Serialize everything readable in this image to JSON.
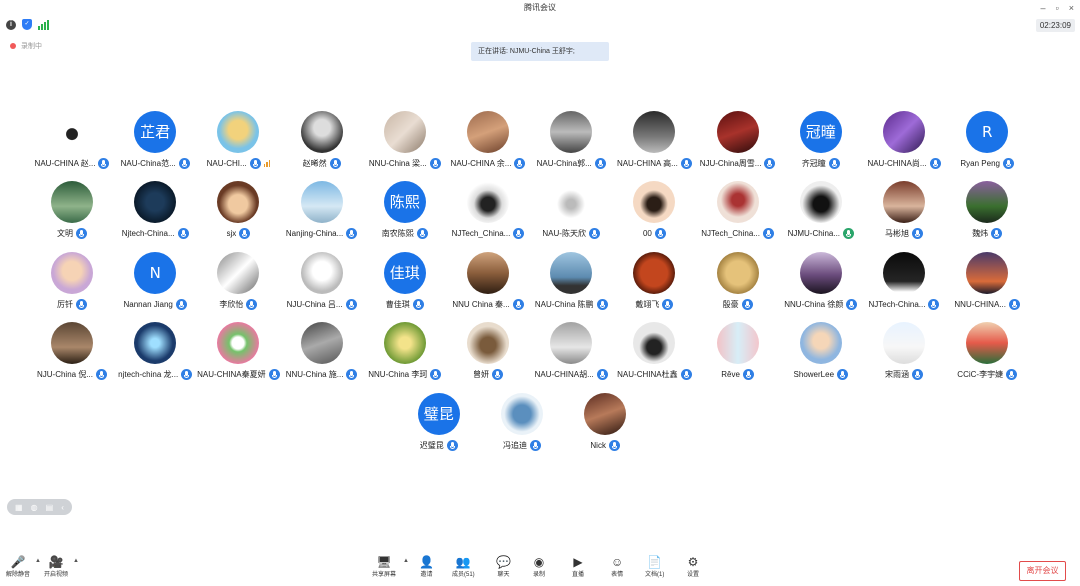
{
  "window": {
    "title": "腾讯会议",
    "minimize": "–",
    "maximize": "▫",
    "close": "×"
  },
  "info_bar": {
    "timer": "02:23:09"
  },
  "recording_label": "录制中",
  "speaking": "正在讲话: NJMU-China 王舒宇;",
  "participants": [
    {
      "name": "NAU-CHINA 赵...",
      "avatar": "photo",
      "style": "p1"
    },
    {
      "name": "NAU-China范...",
      "avatar": "text",
      "text": "芷君"
    },
    {
      "name": "NAU-CHI...",
      "avatar": "photo",
      "style": "p2",
      "signal": true
    },
    {
      "name": "赵晞然",
      "avatar": "photo",
      "style": "p3",
      "nomic": true
    },
    {
      "name": "NNU-China 梁...",
      "avatar": "photo",
      "style": "p4"
    },
    {
      "name": "NAU-CHINA 余...",
      "avatar": "photo",
      "style": "p5"
    },
    {
      "name": "NAU-China郭...",
      "avatar": "photo",
      "style": "p6"
    },
    {
      "name": "NAU-CHINA 高...",
      "avatar": "photo",
      "style": "p7"
    },
    {
      "name": "NJU-China周雪...",
      "avatar": "photo",
      "style": "p8"
    },
    {
      "name": "齐冠瞳",
      "avatar": "text",
      "text": "冠曈"
    },
    {
      "name": "NAU-CHINA尚...",
      "avatar": "photo",
      "style": "p9"
    },
    {
      "name": "Ryan Peng",
      "avatar": "text",
      "text": "R"
    },
    {
      "name": "文明",
      "avatar": "photo",
      "style": "p10"
    },
    {
      "name": "Njtech-China...",
      "avatar": "photo",
      "style": "p11"
    },
    {
      "name": "sjx",
      "avatar": "photo",
      "style": "p12"
    },
    {
      "name": "Nanjing-China...",
      "avatar": "photo",
      "style": "p13"
    },
    {
      "name": "南农陈熙",
      "avatar": "text",
      "text": "陈熙"
    },
    {
      "name": "NJTech_China...",
      "avatar": "photo",
      "style": "p14"
    },
    {
      "name": "NAU-陈天欣",
      "avatar": "photo",
      "style": "p15"
    },
    {
      "name": "00",
      "avatar": "photo",
      "style": "p16"
    },
    {
      "name": "NJTech_China...",
      "avatar": "photo",
      "style": "p17"
    },
    {
      "name": "NJMU-China...",
      "avatar": "photo",
      "style": "p18",
      "green": true
    },
    {
      "name": "马彬旭",
      "avatar": "photo",
      "style": "p19"
    },
    {
      "name": "魏炜",
      "avatar": "photo",
      "style": "p20"
    },
    {
      "name": "厉钎",
      "avatar": "photo",
      "style": "p21"
    },
    {
      "name": "Nannan Jiang",
      "avatar": "text",
      "text": "N"
    },
    {
      "name": "李欣怡",
      "avatar": "photo",
      "style": "p22"
    },
    {
      "name": "NJU-China 吕...",
      "avatar": "photo",
      "style": "p23"
    },
    {
      "name": "曹佳琪",
      "avatar": "text",
      "text": "佳琪"
    },
    {
      "name": "NNU China 秦...",
      "avatar": "photo",
      "style": "p24"
    },
    {
      "name": "NAU-China 陈鹏",
      "avatar": "photo",
      "style": "p25"
    },
    {
      "name": "戴翊飞",
      "avatar": "photo",
      "style": "p26"
    },
    {
      "name": "殷豪",
      "avatar": "photo",
      "style": "p27"
    },
    {
      "name": "NNU-China 徐颜",
      "avatar": "photo",
      "style": "p28"
    },
    {
      "name": "NJTech-China...",
      "avatar": "photo",
      "style": "p29"
    },
    {
      "name": "NNU-CHINA...",
      "avatar": "photo",
      "style": "p30"
    },
    {
      "name": "NJU-China 倪...",
      "avatar": "photo",
      "style": "p31"
    },
    {
      "name": "njtech-china 龙...",
      "avatar": "photo",
      "style": "p32"
    },
    {
      "name": "NAU-CHINA秦夏妍",
      "avatar": "photo",
      "style": "p33"
    },
    {
      "name": "NNU-China 施...",
      "avatar": "photo",
      "style": "p34"
    },
    {
      "name": "NNU-China 李珂",
      "avatar": "photo",
      "style": "p35"
    },
    {
      "name": "曾妍",
      "avatar": "photo",
      "style": "p36"
    },
    {
      "name": "NAU-CHINA胡...",
      "avatar": "photo",
      "style": "p37"
    },
    {
      "name": "NAU-CHINA杜鑫",
      "avatar": "photo",
      "style": "p38"
    },
    {
      "name": "Rêve",
      "avatar": "photo",
      "style": "p39"
    },
    {
      "name": "ShowerLee",
      "avatar": "photo",
      "style": "p40"
    },
    {
      "name": "宋雨涵",
      "avatar": "photo",
      "style": "p41"
    },
    {
      "name": "CCiC-李宇婕",
      "avatar": "photo",
      "style": "p42"
    },
    {
      "name": "迟璧昆",
      "avatar": "text",
      "text": "璧昆"
    },
    {
      "name": "冯追迪",
      "avatar": "photo",
      "style": "p43",
      "nomic": true
    },
    {
      "name": "Nick",
      "avatar": "photo",
      "style": "p44"
    }
  ],
  "view_controls": [
    "▦",
    "◍",
    "▤",
    "‹"
  ],
  "toolbar": {
    "mute": {
      "icon": "🎤",
      "label": "解除静音"
    },
    "video": {
      "icon": "🎥",
      "label": "开启视频"
    },
    "share": {
      "icon": "🖥",
      "label": "共享屏幕"
    },
    "invite": {
      "icon": "👤",
      "label": "邀请"
    },
    "members": {
      "icon": "👥",
      "label": "成员(51)"
    },
    "chat": {
      "icon": "💬",
      "label": "聊天"
    },
    "record": {
      "icon": "◉",
      "label": "录制"
    },
    "live": {
      "icon": "▶",
      "label": "直播"
    },
    "emoji": {
      "icon": "☺",
      "label": "表情"
    },
    "docs": {
      "icon": "📄",
      "label": "文档(1)"
    },
    "settings": {
      "icon": "⚙",
      "label": "设置"
    },
    "leave": "离开会议"
  },
  "colors": {
    "accent": "#1a73e8",
    "mic": "#2f7fe5",
    "leave": "#e24b4b"
  }
}
